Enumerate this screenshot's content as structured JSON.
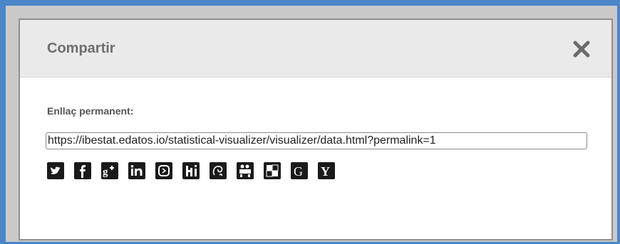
{
  "dialog": {
    "title": "Compartir",
    "close_icon": "close-icon",
    "permalink_label": "Enllaç permanent:",
    "permalink_value": "https://ibestat.edatos.io/statistical-visualizer/visualizer/data.html?permalink=1"
  },
  "share_icons": [
    "twitter-icon",
    "facebook-icon",
    "google-plus-icon",
    "linkedin-icon",
    "meneame-icon",
    "hi5-icon",
    "delicious-icon",
    "myspace-icon",
    "del-icio-us-icon",
    "google-bookmarks-icon",
    "yahoo-icon"
  ],
  "colors": {
    "page_background": "#4a86c8",
    "header_background": "#eaeaea",
    "title_color": "#6e6e6e",
    "icon_color": "#1a1a1a"
  }
}
